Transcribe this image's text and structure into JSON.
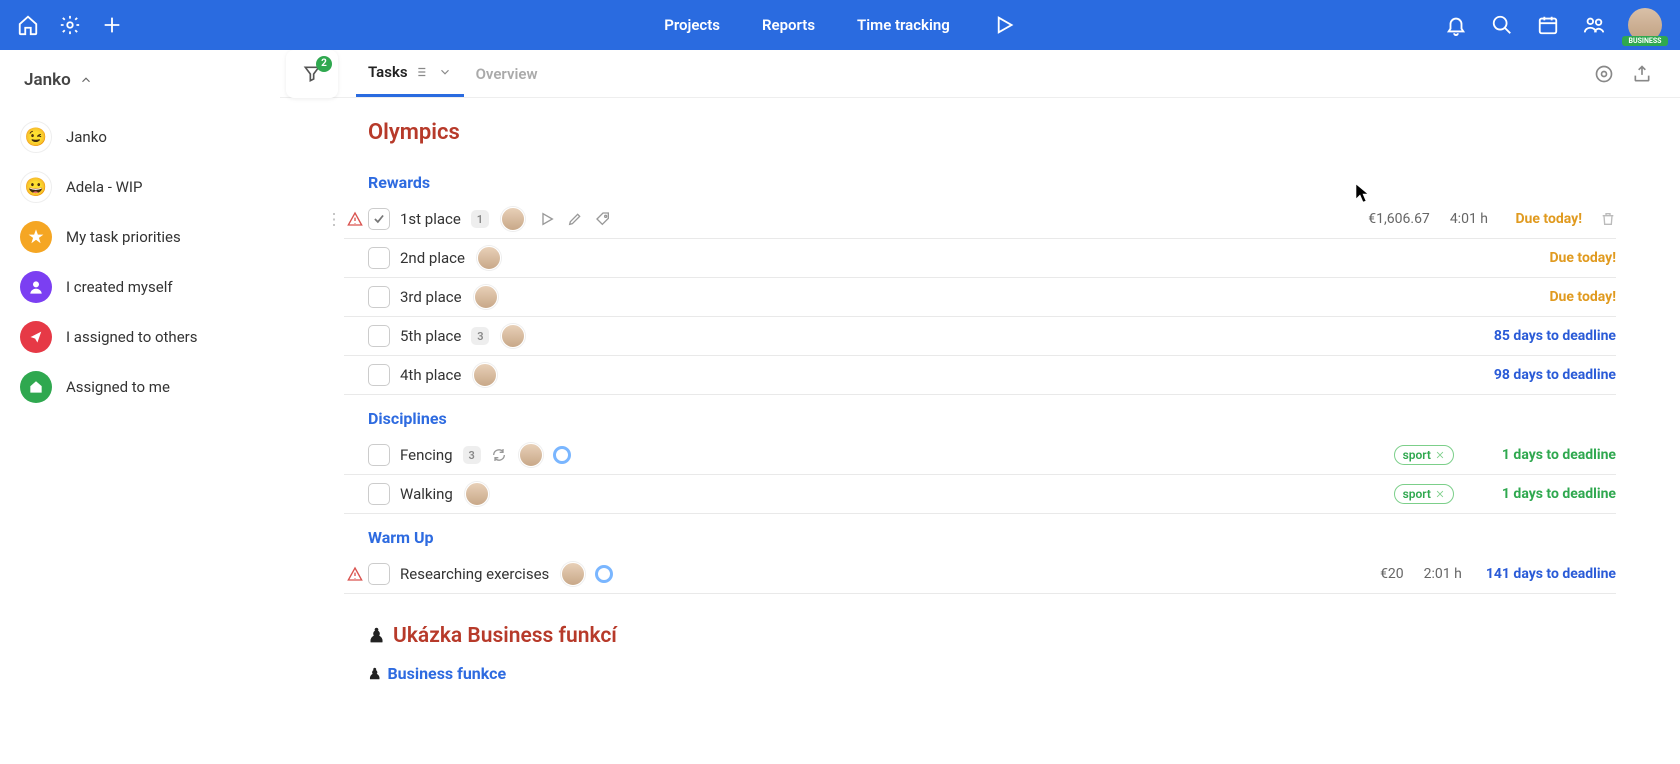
{
  "topbar": {
    "nav": [
      "Projects",
      "Reports",
      "Time tracking"
    ],
    "avatar_badge": "BUSINESS"
  },
  "sidebar": {
    "workspace": "Janko",
    "items": [
      {
        "label": "Janko",
        "icon_type": "emoji",
        "emoji": "😉"
      },
      {
        "label": "Adela - WIP",
        "icon_type": "emoji",
        "emoji": "😀"
      },
      {
        "label": "My task priorities",
        "icon_type": "star"
      },
      {
        "label": "I created myself",
        "icon_type": "person"
      },
      {
        "label": "I assigned to others",
        "icon_type": "share"
      },
      {
        "label": "Assigned to me",
        "icon_type": "home"
      }
    ]
  },
  "tabs": {
    "filter_count": "2",
    "tasks": "Tasks",
    "overview": "Overview"
  },
  "projects": [
    {
      "title": "Olympics",
      "sections": [
        {
          "title": "Rewards",
          "tasks": [
            {
              "name": "1st place",
              "count": "1",
              "avatar": true,
              "hovered": true,
              "warn": true,
              "checked_style": true,
              "price": "€1,606.67",
              "time": "4:01 h",
              "deadline": "Due today!",
              "deadline_cls": "warn"
            },
            {
              "name": "2nd place",
              "avatar": true,
              "deadline": "Due today!",
              "deadline_cls": "warn"
            },
            {
              "name": "3rd place",
              "avatar": true,
              "deadline": "Due today!",
              "deadline_cls": "warn"
            },
            {
              "name": "5th place",
              "count": "3",
              "avatar": true,
              "deadline": "85 days to deadline",
              "deadline_cls": "blue"
            },
            {
              "name": "4th place",
              "avatar": true,
              "deadline": "98 days to deadline",
              "deadline_cls": "blue"
            }
          ]
        },
        {
          "title": "Disciplines",
          "tasks": [
            {
              "name": "Fencing",
              "count": "3",
              "refresh": true,
              "avatar": true,
              "ring": true,
              "tag": "sport",
              "deadline": "1 days to deadline",
              "deadline_cls": "green"
            },
            {
              "name": "Walking",
              "avatar": true,
              "tag": "sport",
              "deadline": "1 days to deadline",
              "deadline_cls": "green"
            }
          ]
        },
        {
          "title": "Warm Up",
          "tasks": [
            {
              "name": "Researching exercises",
              "warn": true,
              "avatar": true,
              "ring": true,
              "price": "€20",
              "time": "2:01 h",
              "deadline": "141 days to deadline",
              "deadline_cls": "blue"
            }
          ]
        }
      ]
    },
    {
      "title": "Ukázka Business funkcí",
      "pawn": true,
      "sections": [
        {
          "title": "Business funkce",
          "pawn": true,
          "tasks": []
        }
      ]
    }
  ]
}
